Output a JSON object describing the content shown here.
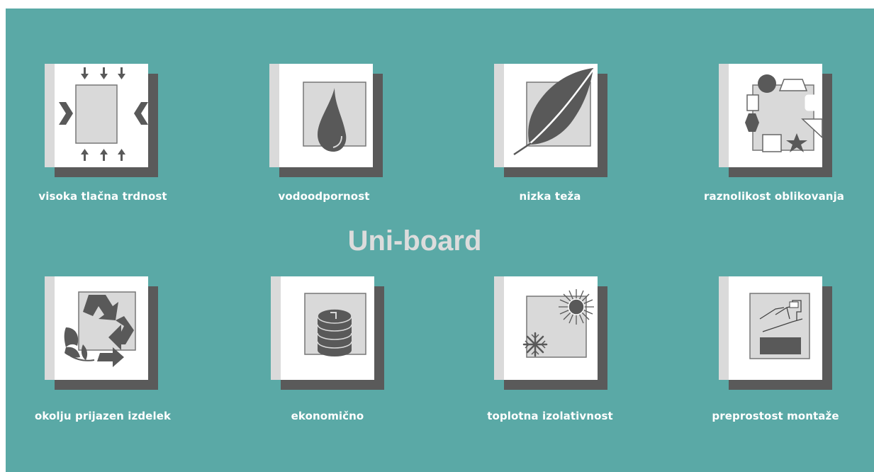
{
  "title": "Uni-board",
  "colors": {
    "background": "#5aa9a6",
    "title": "#dcdcdc",
    "label": "#ffffff",
    "tile_white": "#ffffff",
    "tile_gray": "#dadada",
    "tile_shadow": "#5a5a5a",
    "icon": "#595959"
  },
  "features": [
    {
      "label": "visoka tlačna trdnost",
      "icon": "compression-icon"
    },
    {
      "label": "vodoodpornost",
      "icon": "water-drop-icon"
    },
    {
      "label": "nizka teža",
      "icon": "feather-icon"
    },
    {
      "label": "raznolikost oblikovanja",
      "icon": "shapes-icon"
    },
    {
      "label": "okolju prijazen izdelek",
      "icon": "recycle-icon"
    },
    {
      "label": "ekonomično",
      "icon": "coins-icon"
    },
    {
      "label": "toplotna izolativnost",
      "icon": "sun-snowflake-icon"
    },
    {
      "label": "preprostost montaže",
      "icon": "installation-icon"
    }
  ]
}
